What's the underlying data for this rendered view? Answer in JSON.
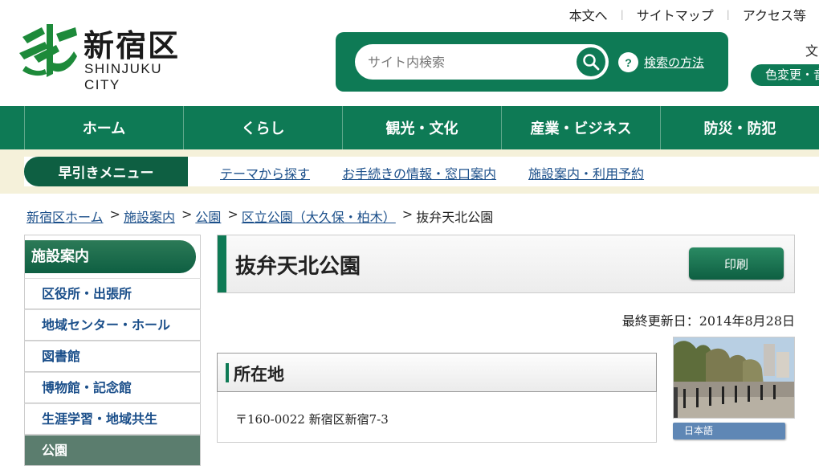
{
  "header": {
    "logo_ja": "新宿区",
    "logo_en": "SHINJUKU CITY",
    "top_links": [
      "本文へ",
      "サイトマップ",
      "アクセス等"
    ],
    "search_placeholder": "サイト内検索",
    "search_help": "検索の方法",
    "help_mark": "?",
    "font_size_label": "文",
    "color_change": "色変更・音"
  },
  "global_nav": [
    "ホーム",
    "くらし",
    "観光・文化",
    "産業・ビジネス",
    "防災・防犯"
  ],
  "quick_menu": {
    "label": "早引きメニュー",
    "links": [
      "テーマから探す",
      "お手続きの情報・窓口案内",
      "施設案内・利用予約"
    ]
  },
  "breadcrumb": {
    "links": [
      "新宿区ホーム",
      "施設案内",
      "公園",
      "区立公園（大久保・柏木）"
    ],
    "separator": ">",
    "current": "抜弁天北公園"
  },
  "sidebar": {
    "title": "施設案内",
    "items": [
      {
        "label": "区役所・出張所"
      },
      {
        "label": "地域センター・ホール"
      },
      {
        "label": "図書館"
      },
      {
        "label": "博物館・記念館"
      },
      {
        "label": "生涯学習・地域共生"
      },
      {
        "label": "公園"
      }
    ],
    "active_index": 5
  },
  "main": {
    "title": "抜弁天北公園",
    "print_label": "印刷",
    "last_updated": "最終更新日：2014年8月28日",
    "section_title": "所在地",
    "address": "〒160-0022 新宿区新宿7-3",
    "language_label": "日本語"
  },
  "colors": {
    "brand_green": "#0e7a55",
    "dark_green": "#0e5f42",
    "link_blue": "#1b4f8a",
    "quick_bar_bg": "#f5f1da",
    "lang_button": "#5f87b5"
  }
}
